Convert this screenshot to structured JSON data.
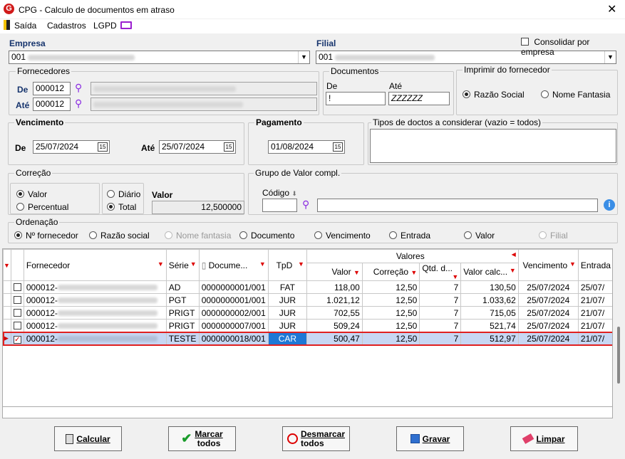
{
  "window": {
    "title": "CPG - Calculo de documentos em atraso",
    "logo": "G"
  },
  "menu": {
    "saida": "Saída",
    "cadastros": "Cadastros",
    "lgpd": "LGPD"
  },
  "empresa": {
    "label": "Empresa",
    "value": "001"
  },
  "filial": {
    "label": "Filial",
    "value": "001"
  },
  "consolidar": {
    "label": "Consolidar por empresa",
    "checked": false
  },
  "fornecedores": {
    "title": "Fornecedores",
    "de_label": "De",
    "de_value": "000012",
    "ate_label": "Até",
    "ate_value": "000012"
  },
  "documentos": {
    "title": "Documentos",
    "de_label": "De",
    "de_value": "!",
    "ate_label": "Até",
    "ate_value": "ZZZZZZ"
  },
  "imprimir": {
    "title": "Imprimir do fornecedor",
    "opt1": "Razão Social",
    "opt2": "Nome Fantasia"
  },
  "vencimento": {
    "title": "Vencimento",
    "de_label": "De",
    "de_value": "25/07/2024",
    "ate_label": "Até",
    "ate_value": "25/07/2024"
  },
  "pagamento": {
    "title": "Pagamento",
    "value": "01/08/2024"
  },
  "tipos": {
    "title": "Tipos de doctos a considerar (vazio = todos)"
  },
  "correcao": {
    "title": "Correção",
    "valor": "Valor",
    "percentual": "Percentual",
    "diario": "Diário",
    "total": "Total",
    "valor_label": "Valor",
    "valor_value": "12,500000"
  },
  "grupo": {
    "title": "Grupo de Valor compl.",
    "codigo_label": "Código"
  },
  "ordenacao": {
    "title": "Ordenação",
    "opts": [
      "Nº fornecedor",
      "Razão social",
      "Nome fantasia",
      "Documento",
      "Vencimento",
      "Entrada",
      "Valor",
      "Filial"
    ]
  },
  "grid": {
    "headers": {
      "fornecedor": "Fornecedor",
      "serie": "Série",
      "documento": "Docume...",
      "tpd": "TpD",
      "valores": "Valores",
      "valor": "Valor",
      "correcao": "Correção",
      "qtd": "Qtd. d...",
      "valorcalc": "Valor calc...",
      "vencimento": "Vencimento",
      "entrada": "Entrada"
    },
    "rows": [
      {
        "forn": "000012-",
        "serie": "AD",
        "doc": "0000000001/001",
        "tpd": "FAT",
        "valor": "118,00",
        "corr": "12,50",
        "qtd": "7",
        "calc": "130,50",
        "venc": "25/07/2024",
        "entr": "25/07/"
      },
      {
        "forn": "000012-",
        "serie": "PGT",
        "doc": "0000000001/001",
        "tpd": "JUR",
        "valor": "1.021,12",
        "corr": "12,50",
        "qtd": "7",
        "calc": "1.033,62",
        "venc": "25/07/2024",
        "entr": "21/07/"
      },
      {
        "forn": "000012-",
        "serie": "PRIGT",
        "doc": "0000000002/001",
        "tpd": "JUR",
        "valor": "702,55",
        "corr": "12,50",
        "qtd": "7",
        "calc": "715,05",
        "venc": "25/07/2024",
        "entr": "21/07/"
      },
      {
        "forn": "000012-",
        "serie": "PRIGT",
        "doc": "0000000007/001",
        "tpd": "JUR",
        "valor": "509,24",
        "corr": "12,50",
        "qtd": "7",
        "calc": "521,74",
        "venc": "25/07/2024",
        "entr": "21/07/"
      },
      {
        "forn": "000012-",
        "serie": "TESTE",
        "doc": "0000000018/001",
        "tpd": "CAR",
        "valor": "500,47",
        "corr": "12,50",
        "qtd": "7",
        "calc": "512,97",
        "venc": "25/07/2024",
        "entr": "21/07/"
      }
    ]
  },
  "buttons": {
    "calcular": "Calcular",
    "marcar1": "Marcar",
    "marcar2": "todos",
    "desmarcar1": "Desmarcar",
    "desmarcar2": "todos",
    "gravar": "Gravar",
    "limpar": "Limpar"
  }
}
